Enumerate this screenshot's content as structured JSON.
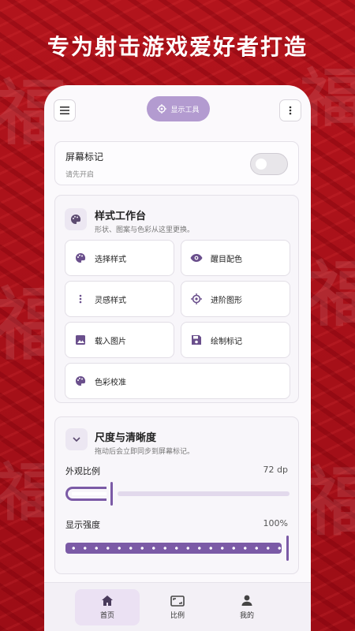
{
  "promo": {
    "headline": "专为射击游戏爱好者打造"
  },
  "topbar": {
    "tool_label": "显示工具"
  },
  "screen_marker": {
    "title": "屏幕标记",
    "subtitle": "请先开启",
    "enabled": false
  },
  "style_workbench": {
    "title": "样式工作台",
    "subtitle": "形状、图案与色彩从这里更换。",
    "tiles": [
      {
        "label": "选择样式",
        "icon": "palette-icon"
      },
      {
        "label": "醒目配色",
        "icon": "eye-icon"
      },
      {
        "label": "灵感样式",
        "icon": "dots-vertical-icon"
      },
      {
        "label": "进阶图形",
        "icon": "crosshair-icon"
      },
      {
        "label": "载入图片",
        "icon": "image-icon"
      },
      {
        "label": "绘制标记",
        "icon": "save-icon"
      },
      {
        "label": "色彩校准",
        "icon": "palette-icon"
      }
    ]
  },
  "scale_section": {
    "title": "尺度与清晰度",
    "subtitle": "拖动后会立即同步到屏幕标记。",
    "size": {
      "label": "外观比例",
      "value": "72 dp"
    },
    "intensity": {
      "label": "显示强度",
      "value": "100%",
      "level": 1.0
    }
  },
  "bottom_nav": {
    "items": [
      {
        "label": "首页",
        "icon": "home-icon",
        "active": true
      },
      {
        "label": "比例",
        "icon": "aspect-ratio-icon",
        "active": false
      },
      {
        "label": "我的",
        "icon": "person-icon",
        "active": false
      }
    ]
  },
  "colors": {
    "accent": "#7b5aa6",
    "background_red": "#b0121b",
    "pill": "#b39bd0"
  }
}
